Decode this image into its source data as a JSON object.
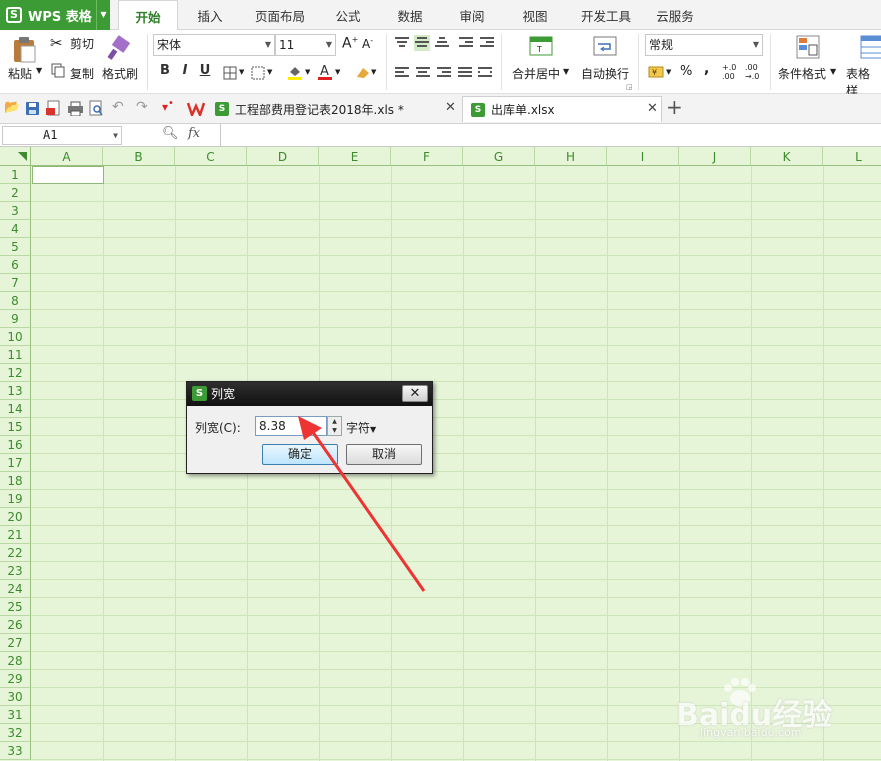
{
  "app": {
    "logo": "S",
    "name": "WPS 表格"
  },
  "menu_tabs": [
    "开始",
    "插入",
    "页面布局",
    "公式",
    "数据",
    "审阅",
    "视图",
    "开发工具",
    "云服务"
  ],
  "ribbon": {
    "paste": "粘贴",
    "cut": "剪切",
    "copy": "复制",
    "format_painter": "格式刷",
    "font_name": "宋体",
    "font_size": "11",
    "bold": "B",
    "italic": "I",
    "underline": "U",
    "merge_center": "合并居中",
    "wrap_text": "自动换行",
    "number_format": "常规",
    "percent": "%",
    "comma": ",",
    "conditional_format": "条件格式",
    "table_style": "表格样"
  },
  "documents": [
    {
      "name": "工程部费用登记表2018年.xls *",
      "active": false
    },
    {
      "name": "出库单.xlsx",
      "active": true
    }
  ],
  "formula_bar": {
    "name_box": "A1",
    "fx": "fx",
    "value": ""
  },
  "columns": [
    "A",
    "B",
    "C",
    "D",
    "E",
    "F",
    "G",
    "H",
    "I",
    "J",
    "K",
    "L"
  ],
  "rows": [
    "1",
    "2",
    "3",
    "4",
    "5",
    "6",
    "7",
    "8",
    "9",
    "10",
    "11",
    "12",
    "13",
    "14",
    "15",
    "16",
    "17",
    "18",
    "19",
    "20",
    "21",
    "22",
    "23",
    "24",
    "25",
    "26",
    "27",
    "28",
    "29",
    "30",
    "31",
    "32",
    "33"
  ],
  "dialog": {
    "title": "列宽",
    "field_label": "列宽(C):",
    "value": "8.38",
    "unit": "字符",
    "ok": "确定",
    "cancel": "取消"
  },
  "watermark": {
    "brand": "Baidu经验",
    "url": "jingyan.baidu.com"
  },
  "colors": {
    "accent": "#3d9b35",
    "grid_bg": "#e6f4d8",
    "arrow": "#ee3333"
  }
}
